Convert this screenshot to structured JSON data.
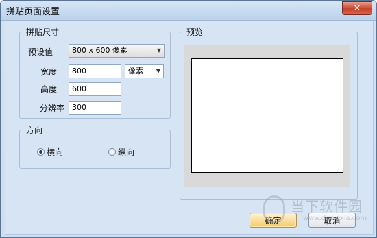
{
  "window": {
    "title": "拼贴页面设置",
    "close_glyph": "✕"
  },
  "size_group": {
    "label": "拼贴尺寸",
    "preset_label": "预设值",
    "preset_value": "800 x 600 像素",
    "width_label": "宽度",
    "width_value": "800",
    "unit_value": "像素",
    "height_label": "高度",
    "height_value": "600",
    "resolution_label": "分辨率",
    "resolution_value": "300"
  },
  "orientation_group": {
    "label": "方向",
    "landscape_label": "横向",
    "portrait_label": "纵向",
    "selected": "landscape"
  },
  "preview_group": {
    "label": "预览"
  },
  "buttons": {
    "ok_label": "确定",
    "cancel_label": "取消"
  },
  "watermark": {
    "text": "当下软件园",
    "url": "www.downxia.com"
  },
  "icons": {
    "dropdown": "chevron-down-icon",
    "close": "close-icon",
    "radio_selected": "radio-dot-icon"
  },
  "colors": {
    "window_bg": "#d6e4f4",
    "close_button": "#c7412a",
    "default_button": "#f5c866"
  }
}
